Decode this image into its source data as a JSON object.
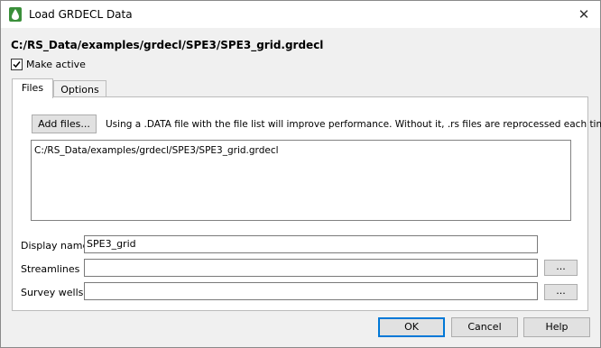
{
  "window": {
    "title": "Load GRDECL Data",
    "close_glyph": "✕",
    "icon": "droplet-icon"
  },
  "header": {
    "path": "C:/RS_Data/examples/grdecl/SPE3/SPE3_grid.grdecl"
  },
  "make_active": {
    "label": "Make active",
    "checked": true
  },
  "tabs": [
    {
      "label": "Files",
      "selected": true
    },
    {
      "label": "Options",
      "selected": false
    }
  ],
  "files_tab": {
    "add_button": "Add files...",
    "info": "Using a .DATA file with the file list will improve performance.  Without it, .rs files are reprocessed each time.",
    "file_list": [
      "C:/RS_Data/examples/grdecl/SPE3/SPE3_grid.grdecl"
    ]
  },
  "fields": {
    "display_name": {
      "label": "Display name",
      "value": "SPE3_grid"
    },
    "streamlines": {
      "label": "Streamlines",
      "value": "",
      "browse": "..."
    },
    "survey_wells": {
      "label": "Survey wells",
      "value": "",
      "browse": "..."
    }
  },
  "buttons": {
    "ok": "OK",
    "cancel": "Cancel",
    "help": "Help"
  }
}
